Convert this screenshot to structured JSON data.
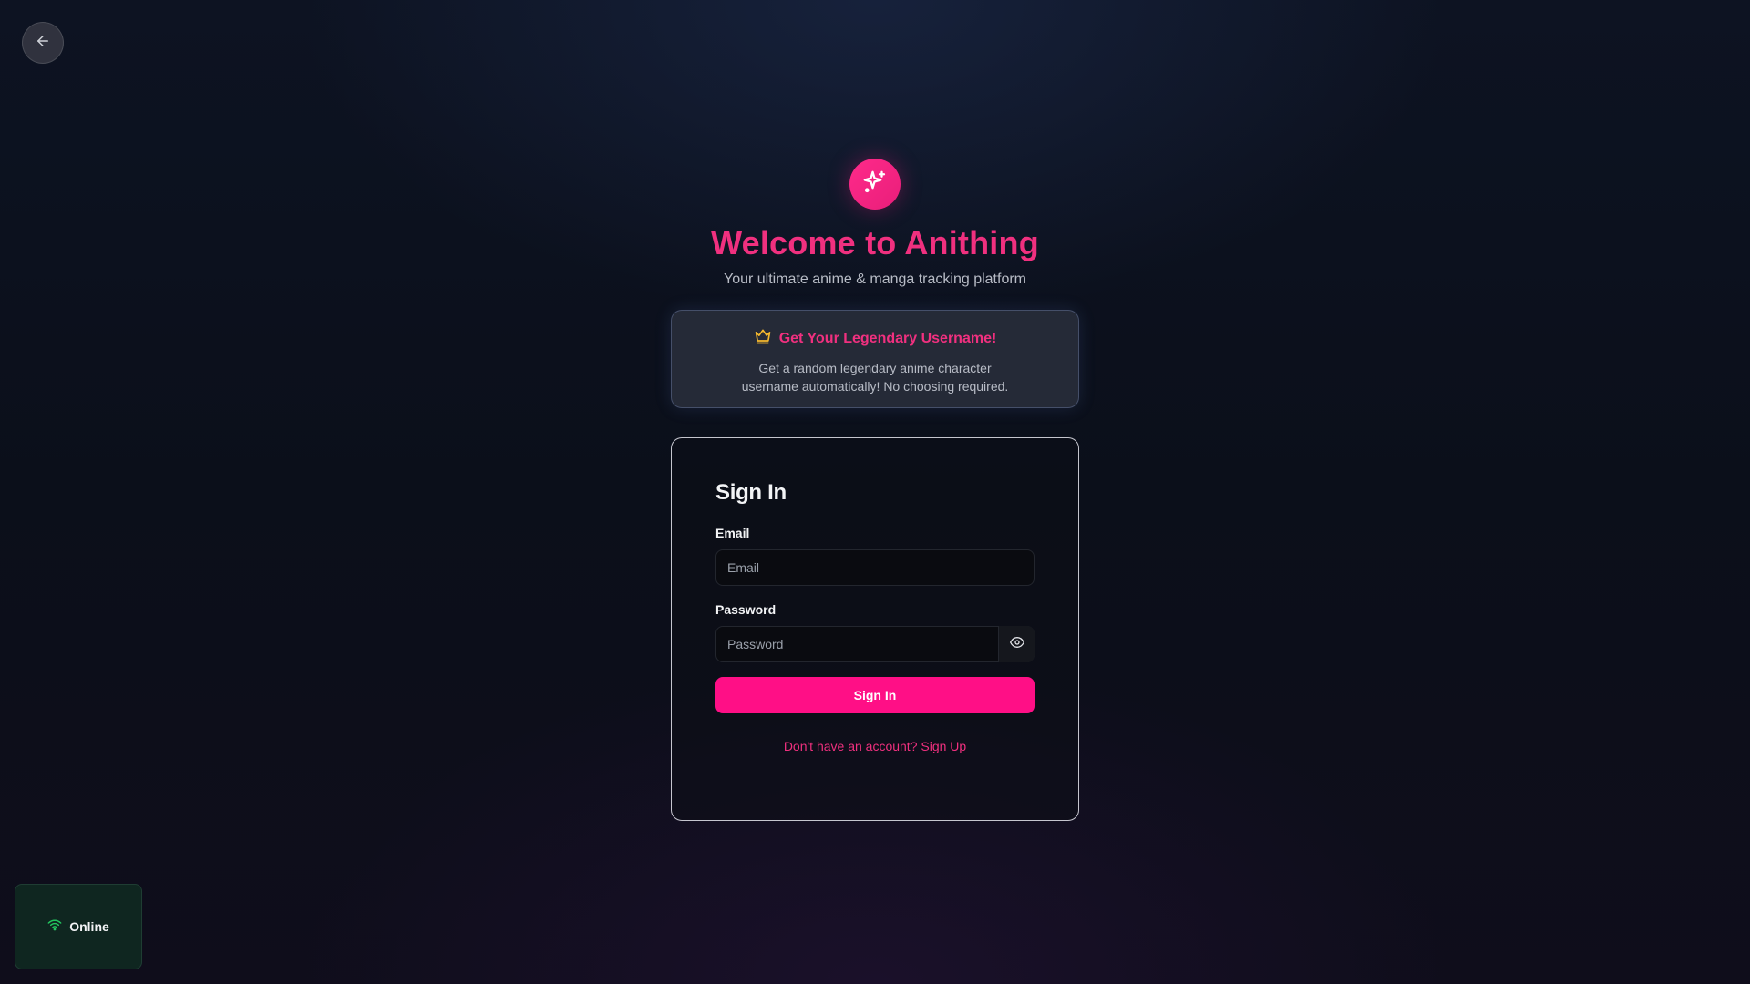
{
  "nav": {
    "back_icon": "arrow-left-icon"
  },
  "brand": {
    "logo_icon": "sparkles-icon",
    "title": "Welcome to Anithing",
    "subtitle": "Your ultimate anime & manga tracking platform",
    "accent_color": "#f0307f"
  },
  "promo": {
    "icon": "crown-icon",
    "heading": "Get Your Legendary Username!",
    "text": "Get a random legendary anime character username automatically! No choosing required."
  },
  "signin": {
    "title": "Sign In",
    "email_label": "Email",
    "email_value": "",
    "email_placeholder": "Email",
    "password_label": "Password",
    "password_value": "",
    "password_placeholder": "Password",
    "toggle_icon": "eye-icon",
    "submit_label": "Sign In",
    "submit_color": "#ff0f86",
    "signup_text": "Don't have an account? Sign Up"
  },
  "status": {
    "icon": "wifi-icon",
    "label": "Online",
    "color": "#22c55e"
  }
}
